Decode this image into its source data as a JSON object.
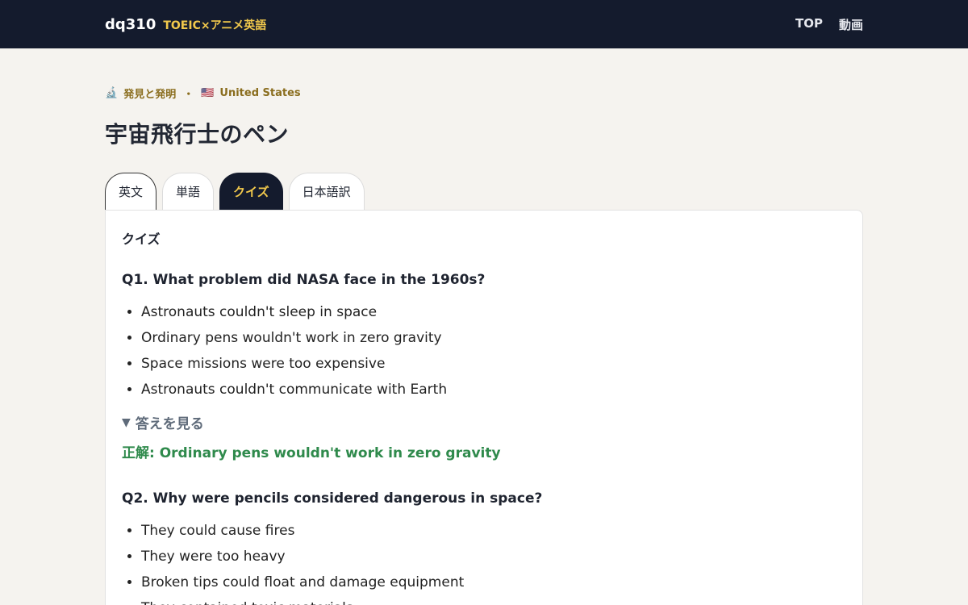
{
  "header": {
    "brand": "dq310",
    "tagline": "TOEIC×アニメ英語",
    "nav": [
      "TOP",
      "動画"
    ]
  },
  "meta": {
    "category_icon": "🔬",
    "category": "発見と発明",
    "separator": "・",
    "country_flag": "🇺🇸",
    "country": "United States"
  },
  "title": "宇宙飛行士のペン",
  "tabs": [
    "英文",
    "単語",
    "クイズ",
    "日本語訳"
  ],
  "active_tab": "クイズ",
  "quiz": {
    "heading": "クイズ",
    "questions": [
      {
        "question": "Q1. What problem did NASA face in the 1960s?",
        "options": [
          "Astronauts couldn't sleep in space",
          "Ordinary pens wouldn't work in zero gravity",
          "Space missions were too expensive",
          "Astronauts couldn't communicate with Earth"
        ],
        "toggle_label": "答えを見る",
        "answer": "正解: Ordinary pens wouldn't work in zero gravity"
      },
      {
        "question": "Q2. Why were pencils considered dangerous in space?",
        "options": [
          "They could cause fires",
          "They were too heavy",
          "Broken tips could float and damage equipment",
          "They contained toxic materials"
        ]
      }
    ]
  },
  "colors": {
    "header_bg": "#141b2d",
    "accent": "#f2c94c",
    "meta": "#8a6d1e",
    "answer": "#2f8a4c"
  }
}
